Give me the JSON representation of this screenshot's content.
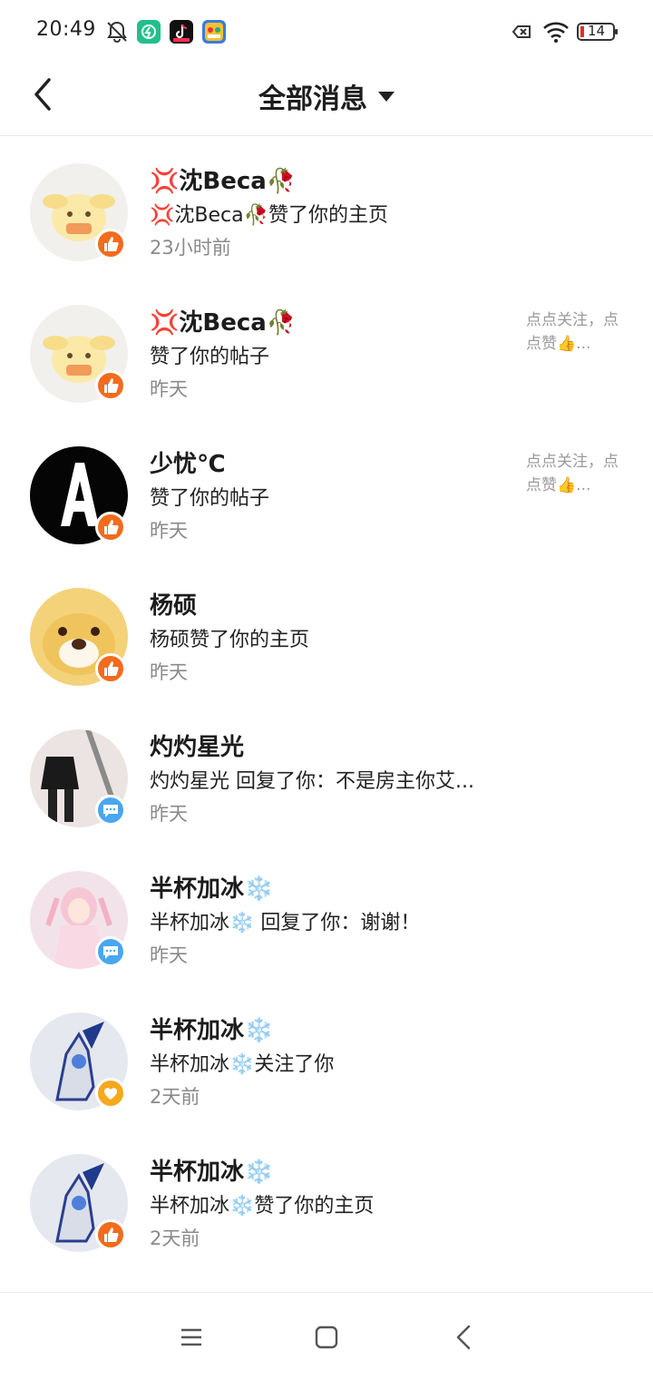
{
  "status_bar": {
    "time": "20:49",
    "battery": "14",
    "icons": [
      "mute-bell-icon",
      "app-icon-green",
      "app-icon-tiktok",
      "app-icon-game",
      "sim-no-signal-icon",
      "wifi-icon",
      "battery-icon"
    ]
  },
  "header": {
    "title": "全部消息",
    "back_icon": "back-arrow-icon",
    "dropdown_icon": "caret-down-icon"
  },
  "messages": [
    {
      "name": "💢沈Beca🥀",
      "text": "💢沈Beca🥀赞了你的主页",
      "time": "23小时前",
      "badge": "like",
      "preview": ""
    },
    {
      "name": "💢沈Beca🥀",
      "text": "赞了你的帖子",
      "time": "昨天",
      "badge": "like",
      "preview": "点点关注，点点赞👍..."
    },
    {
      "name": "少忧℃",
      "text": "赞了你的帖子",
      "time": "昨天",
      "badge": "like",
      "preview": "点点关注，点点赞👍..."
    },
    {
      "name": "杨硕",
      "text": "杨硕赞了你的主页",
      "time": "昨天",
      "badge": "like",
      "preview": ""
    },
    {
      "name": "灼灼星光",
      "text": "灼灼星光 回复了你：不是房主你艾...",
      "time": "昨天",
      "badge": "reply",
      "preview": ""
    },
    {
      "name": "半杯加冰❄️",
      "text": "半杯加冰❄️ 回复了你：谢谢！",
      "time": "昨天",
      "badge": "reply",
      "preview": ""
    },
    {
      "name": "半杯加冰❄️",
      "text": "半杯加冰❄️关注了你",
      "time": "2天前",
      "badge": "follow",
      "preview": ""
    },
    {
      "name": "半杯加冰❄️",
      "text": "半杯加冰❄️赞了你的主页",
      "time": "2天前",
      "badge": "like",
      "preview": ""
    }
  ],
  "nav_bar": {
    "icons": [
      "menu-icon",
      "home-square-icon",
      "back-triangle-icon"
    ]
  },
  "colors": {
    "like_badge": "#f36b1c",
    "reply_badge": "#4aa6f0",
    "follow_badge": "#f7a81c",
    "time_text": "#8a8a8a",
    "preview_text": "#9a9a9a"
  }
}
